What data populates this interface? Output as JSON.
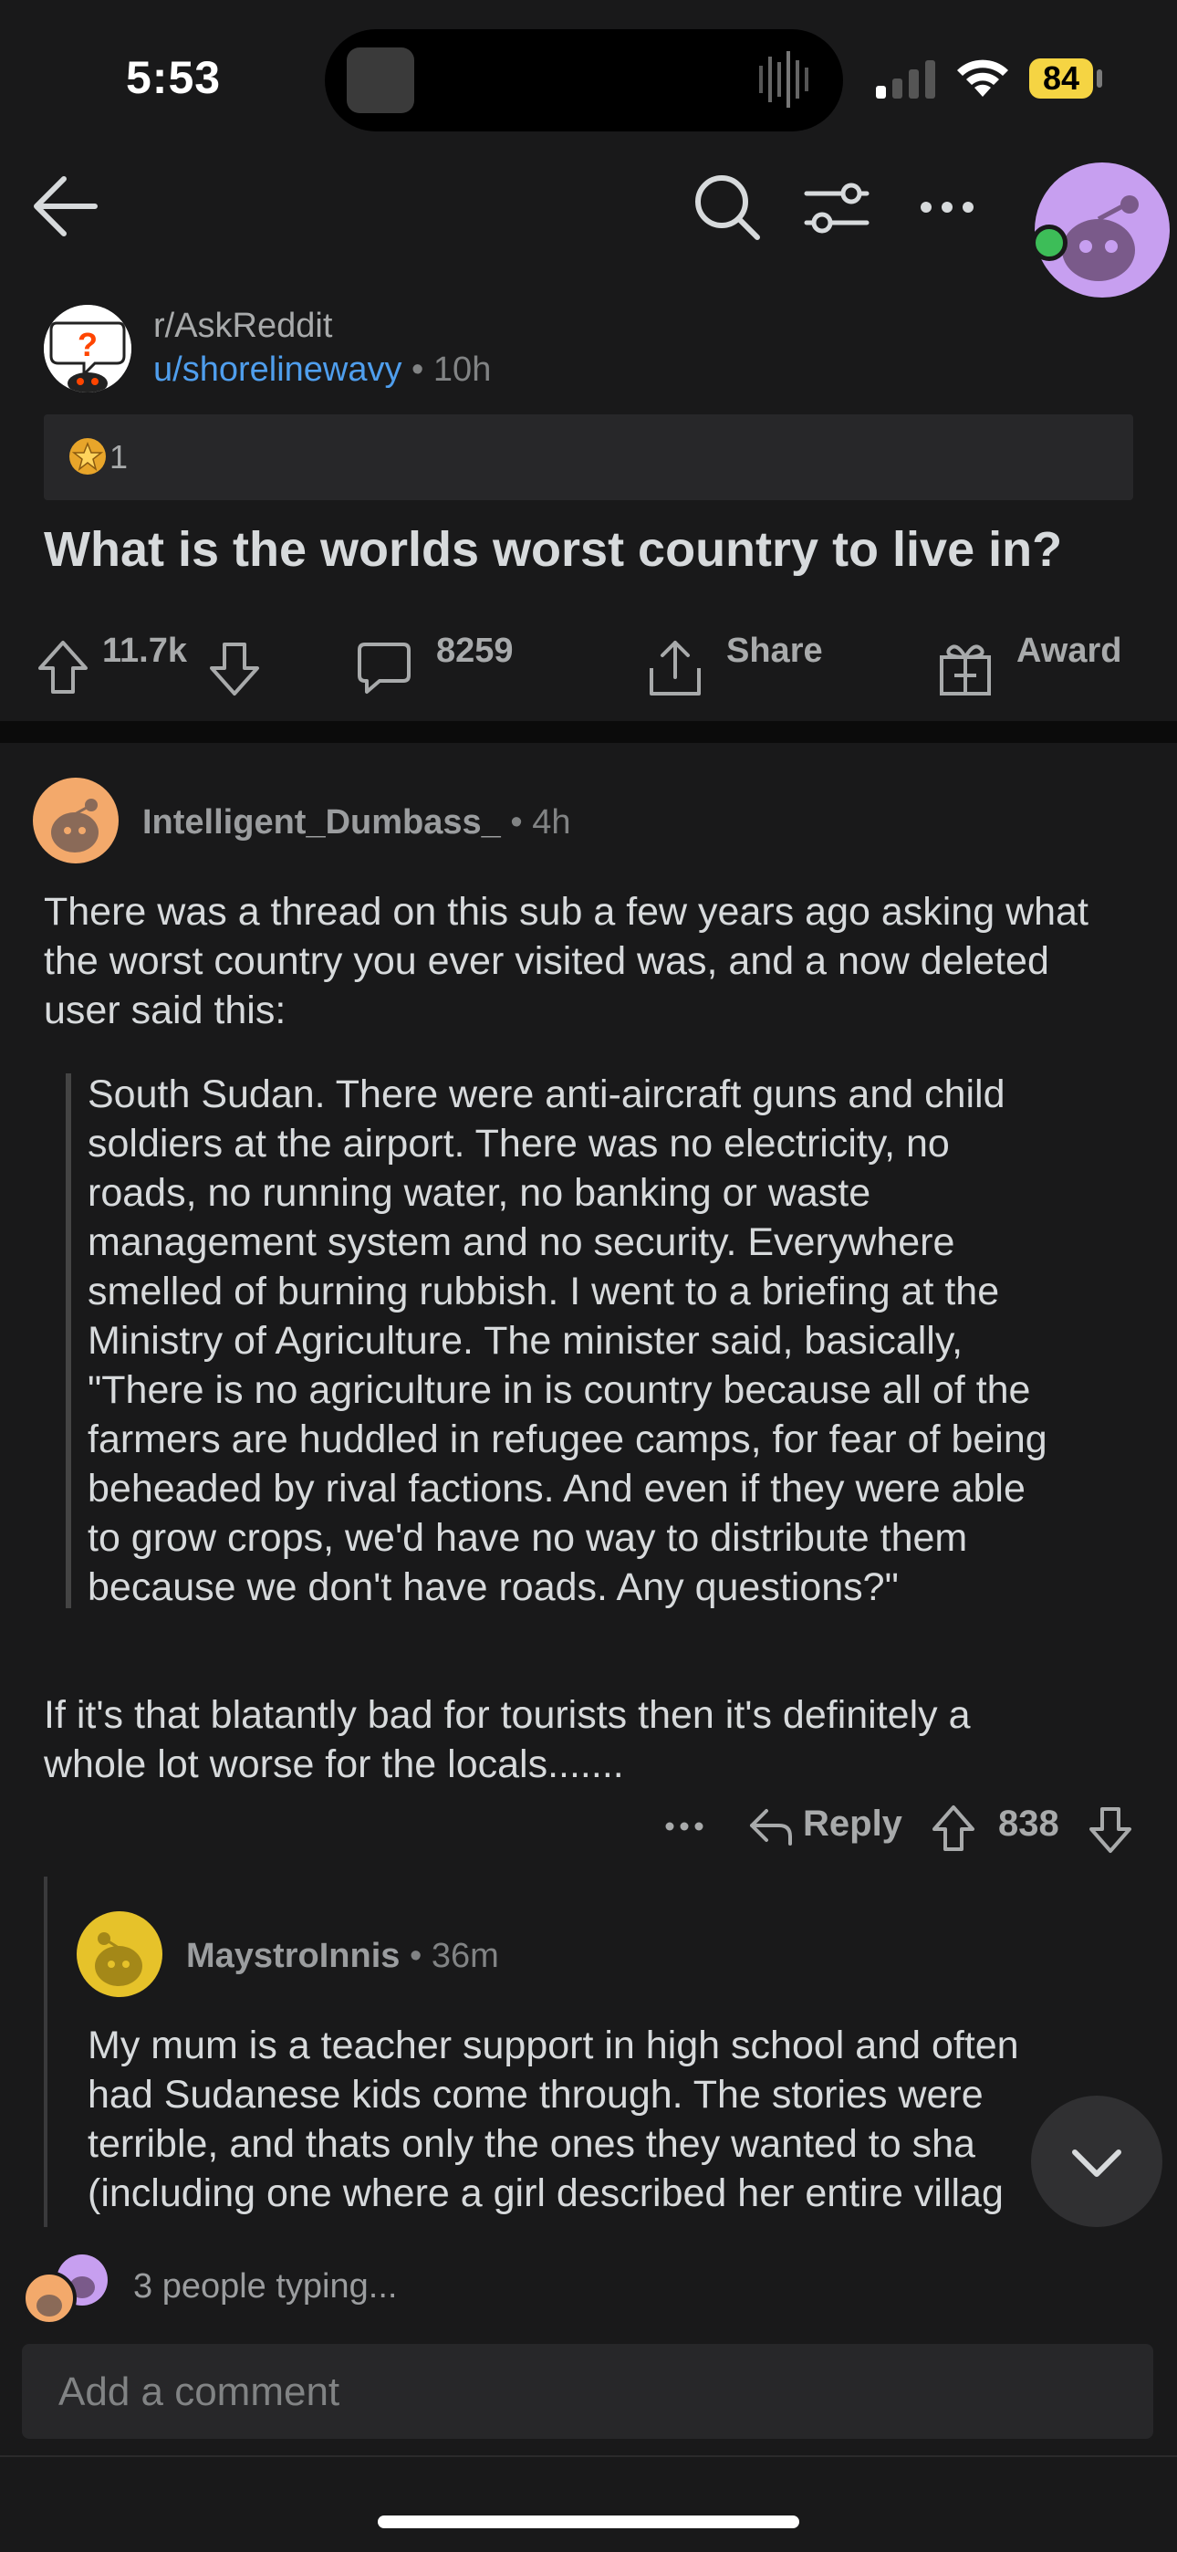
{
  "status_bar": {
    "time": "5:53",
    "battery": "84"
  },
  "post": {
    "subreddit": "r/AskReddit",
    "author": "u/shorelinewavy",
    "age": "10h",
    "award_count": "1",
    "title": "What is the worlds worst country to live in?",
    "score": "11.7k",
    "comment_count": "8259",
    "share_label": "Share",
    "award_label": "Award"
  },
  "comments": [
    {
      "author": "Intelligent_Dumbass_",
      "age": "4h",
      "intro": "There was a thread on this sub a few years ago asking what the worst country you ever visited was, and a now deleted user said this:",
      "quote_lines": [
        "South Sudan. There were anti-aircraft guns and child",
        "soldiers at the airport. There was no electricity, no",
        "roads, no running water, no banking or waste",
        "management system and no security. Everywhere",
        "smelled of burning rubbish. I went to a briefing at the",
        "Ministry of Agriculture. The minister said, basically,",
        "\"There is no agriculture in is country because all of the",
        "farmers are huddled in refugee camps, for fear of being",
        "beheaded by rival factions. And even if they were able",
        "to grow crops, we'd have no way to distribute them",
        "because we don't have roads. Any questions?\""
      ],
      "outro_lines": [
        "If it's that blatantly bad for tourists then it's definitely a",
        "whole lot worse for the locals......."
      ],
      "reply_label": "Reply",
      "score": "838"
    },
    {
      "author": "MaystroInnis",
      "age": "36m",
      "body_lines": [
        "My mum is a teacher support in high school and often",
        "had Sudanese kids come through. The stories were",
        "terrible, and thats only the ones they wanted to sha",
        "(including one where a girl described her entire villag"
      ]
    }
  ],
  "typing_indicator": "3 people typing...",
  "comment_input": {
    "placeholder": "Add a comment"
  },
  "colors": {
    "background": "#19191a",
    "username_link": "#4f9eed",
    "battery": "#f5d443",
    "online": "#3dbd58"
  }
}
